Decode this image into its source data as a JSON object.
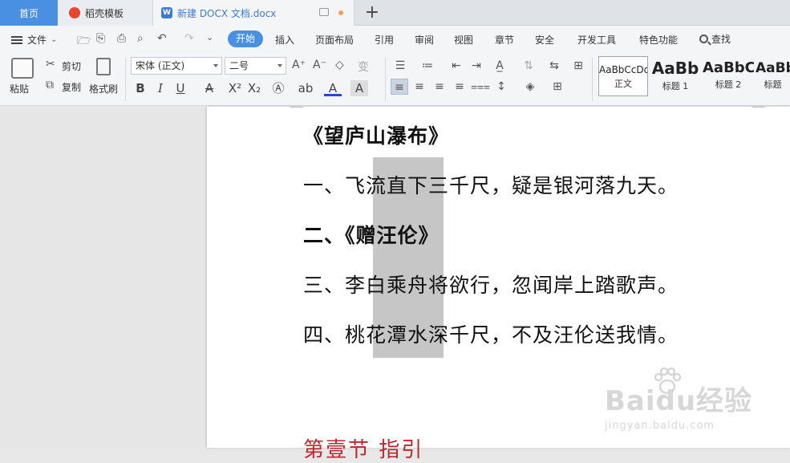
{
  "tabs": {
    "home": "首页",
    "template": "稻壳模板",
    "doc": "新建 DOCX 文档.docx",
    "template_icon": "flame-icon",
    "doc_icon": "word-doc-icon",
    "doc_icon_glyph": "W"
  },
  "menu": {
    "file": "文件",
    "active": "开始",
    "items": [
      "插入",
      "页面布局",
      "引用",
      "审阅",
      "视图",
      "章节",
      "安全",
      "开发工具",
      "特色功能"
    ],
    "search": "查找"
  },
  "ribbon": {
    "paste": "粘贴",
    "cut": "剪切",
    "copy": "复制",
    "format_painter": "格式刷",
    "font_name": "宋体 (正文)",
    "font_size": "二号",
    "bold": "B",
    "italic": "I",
    "underline": "U",
    "styles": [
      {
        "sample": "AaBbCcDd",
        "name": "正文"
      },
      {
        "sample": "AaBb",
        "name": "标题 1"
      },
      {
        "sample": "AaBbC",
        "name": "标题 2"
      },
      {
        "sample": "AaBb",
        "name": "标题"
      }
    ]
  },
  "document": {
    "lines": [
      "《望庐山瀑布》",
      "一、飞流直下三千尺，疑是银河落九天。",
      "二、《赠汪伦》",
      "三、李白乘舟将欲行，忽闻岸上踏歌声。",
      "四、桃花潭水深千尺，不及汪伦送我情。"
    ],
    "red_heading": "第壹节 指引"
  },
  "watermark": {
    "logo": "Baidu经验",
    "sub": "jingyan.baidu.com"
  },
  "colors": {
    "accent": "#4a90e2",
    "selection": "#c6c6c6",
    "heading_red": "#c0262d"
  }
}
